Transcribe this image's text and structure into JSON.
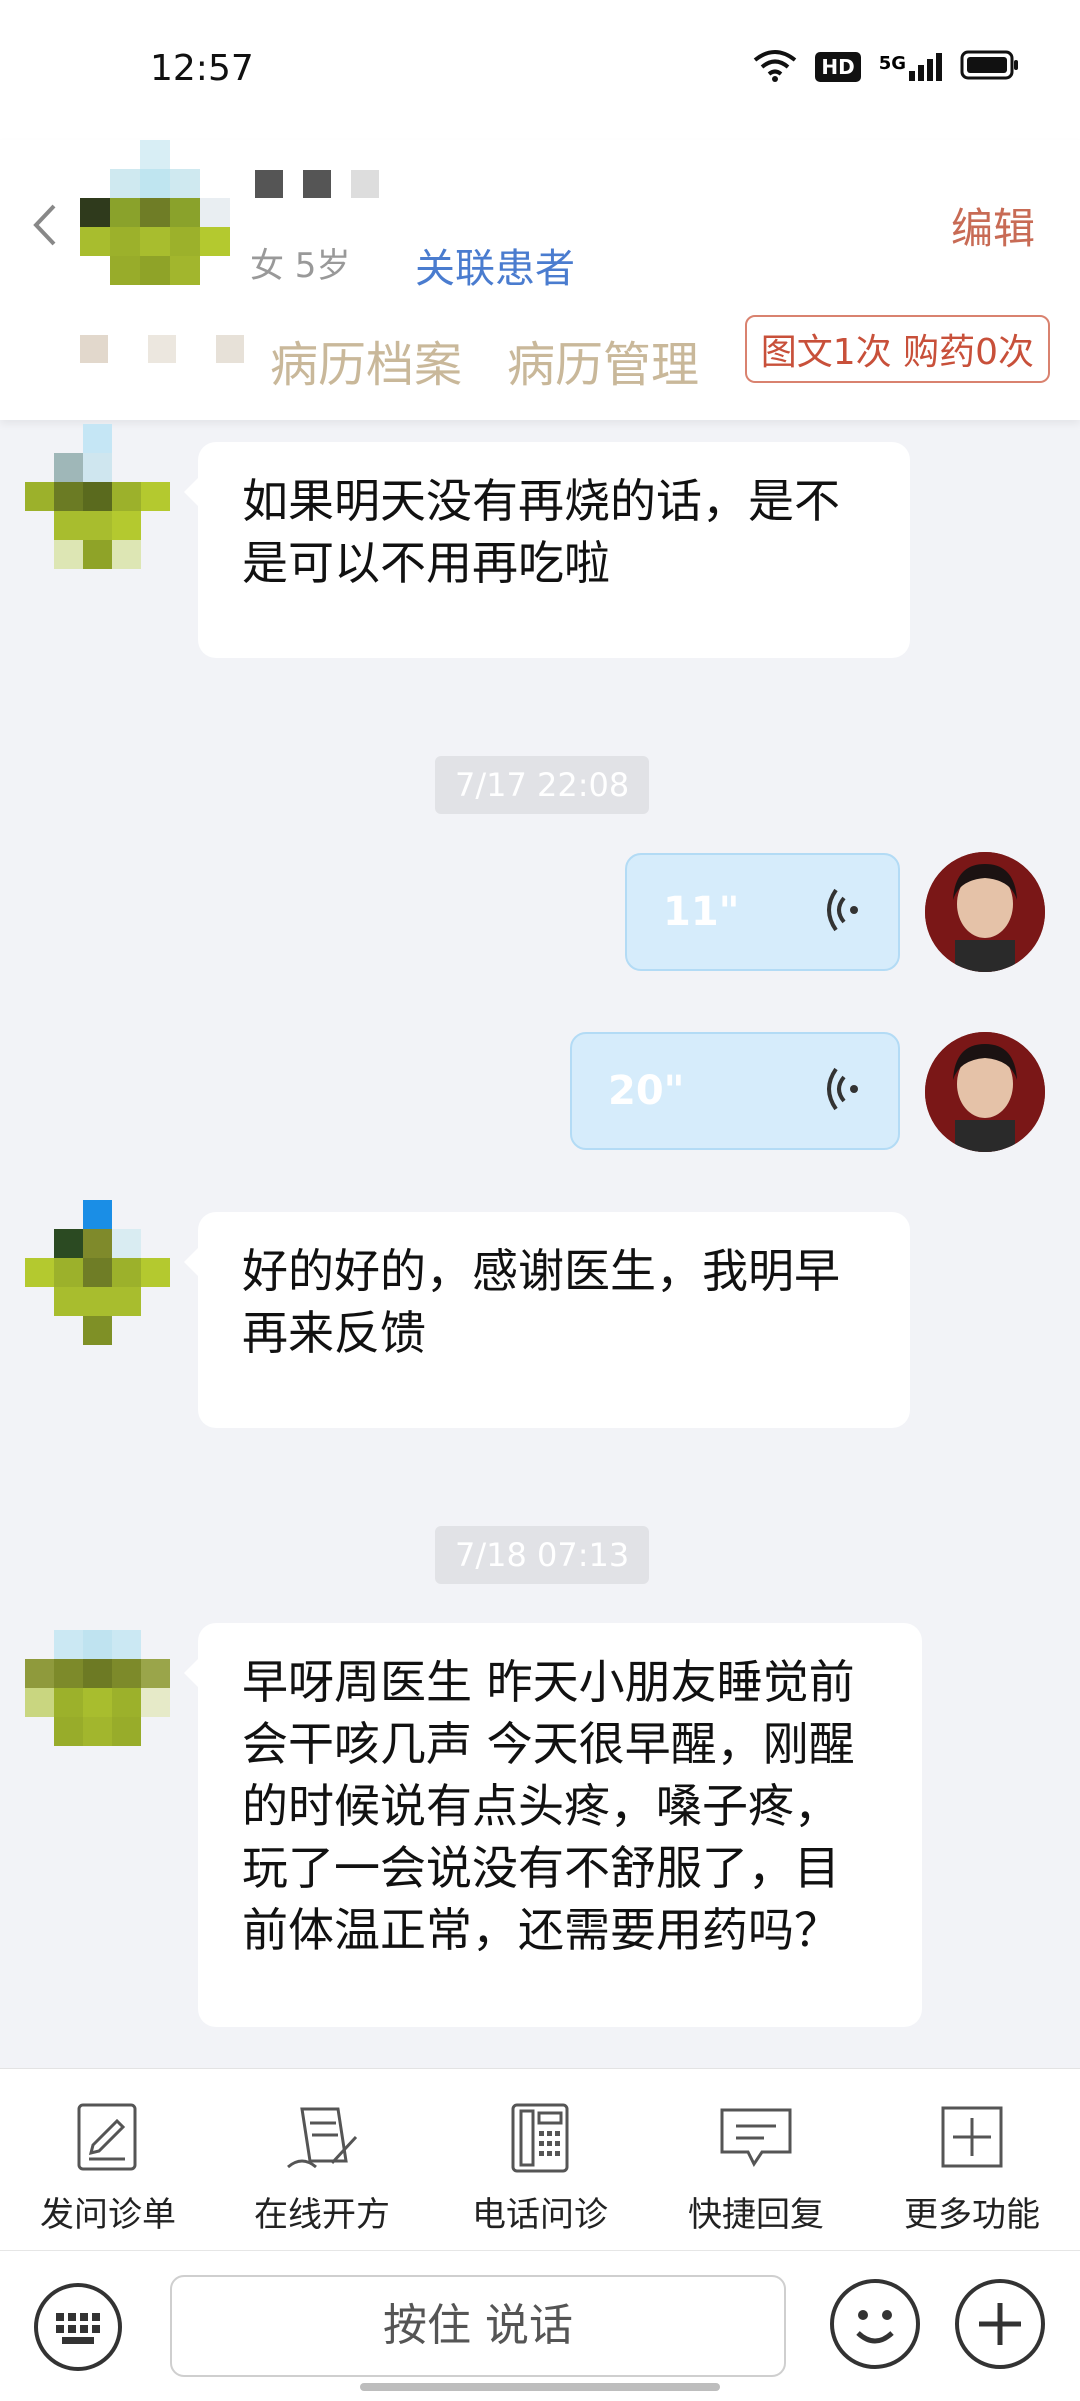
{
  "status_bar": {
    "time": "12:57",
    "hd_label": "HD",
    "network_label": "5G"
  },
  "header": {
    "gender_age": "女 5岁",
    "link_patient": "关联患者",
    "edit": "编辑",
    "tabs": [
      "病历档案",
      "病历管理"
    ],
    "badge": "图文1次 购药0次"
  },
  "messages": [
    {
      "type": "text",
      "side": "left",
      "text": "如果明天没有再烧的话，是不是可以不用再吃啦"
    },
    {
      "type": "time",
      "text": "7/17 22:08"
    },
    {
      "type": "voice",
      "side": "right",
      "duration": "11\""
    },
    {
      "type": "voice",
      "side": "right",
      "duration": "20\""
    },
    {
      "type": "text",
      "side": "left",
      "text": "好的好的，感谢医生，我明早再来反馈"
    },
    {
      "type": "time",
      "text": "7/18 07:13"
    },
    {
      "type": "text",
      "side": "left",
      "text": "早呀周医生 昨天小朋友睡觉前会干咳几声 今天很早醒，刚醒的时候说有点头疼，嗓子疼，玩了一会说没有不舒服了，目前体温正常，还需要用药吗？"
    }
  ],
  "toolbar": {
    "items": [
      {
        "label": "发问诊单",
        "icon": "form-edit-icon"
      },
      {
        "label": "在线开方",
        "icon": "prescription-icon"
      },
      {
        "label": "电话问诊",
        "icon": "phone-icon"
      },
      {
        "label": "快捷回复",
        "icon": "quick-reply-icon"
      },
      {
        "label": "更多功能",
        "icon": "plus-square-icon"
      }
    ]
  },
  "input_bar": {
    "hold_to_talk": "按住 说话"
  },
  "colors": {
    "accent_blue": "#4a7ccf",
    "edit_red": "#c86b55",
    "voice_bubble": "#d6ecfb",
    "bg": "#f2f3f7"
  }
}
